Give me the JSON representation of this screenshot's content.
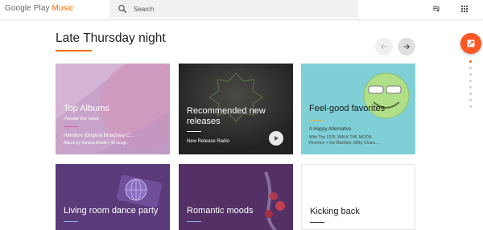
{
  "app": {
    "logo_main": "Google Play ",
    "logo_accent": "Music"
  },
  "search": {
    "placeholder": "Search",
    "value": ""
  },
  "section": {
    "title": "Late Thursday night"
  },
  "cards": [
    {
      "title": "Top Albums",
      "subtitle": "Popular this week",
      "name": "Hamilton (Original Broadway C...",
      "desc": "Album by Various Artists • 46 songs"
    },
    {
      "title_line1": "Recommended new",
      "title_line2": "releases",
      "name": "New Release Radio"
    },
    {
      "title": "Feel-good favorites",
      "name": "A Happy Alternative",
      "desc_line1": "With The 1975, WALK THE MOON,",
      "desc_line2": "Florence + the Machine, Milky Chanc..."
    },
    {
      "title": "Living room dance party"
    },
    {
      "title": "Romantic moods"
    },
    {
      "title": "Kicking back"
    }
  ],
  "colors": {
    "accent": "#ef6c00",
    "fab": "#ff5722"
  },
  "icons": {
    "search": "search-icon",
    "queue": "queue-icon",
    "apps": "apps-icon",
    "prev": "arrow-left-icon",
    "next": "arrow-right-icon",
    "shuffle": "shuffle-icon",
    "play": "play-icon"
  }
}
